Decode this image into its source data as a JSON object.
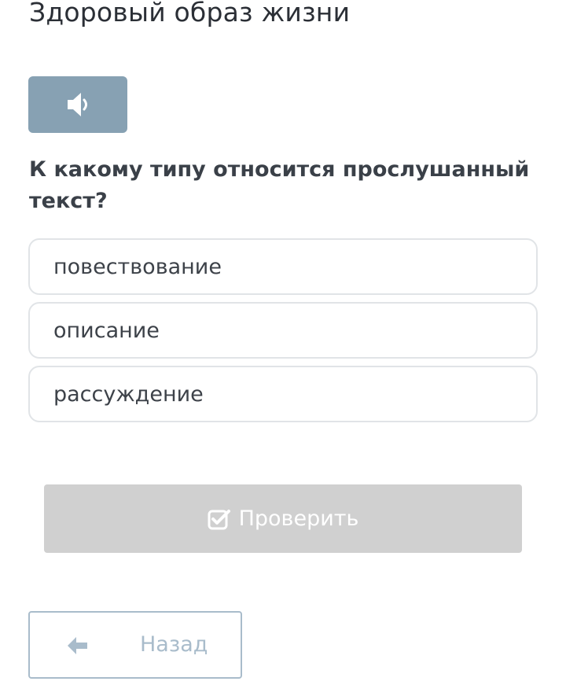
{
  "header": {
    "title": "Здоровый образ жизни"
  },
  "audio": {
    "icon": "speaker-icon",
    "color": "#87a1b3"
  },
  "question": {
    "text": "К какому типу относится прослушанный текст?"
  },
  "options": [
    {
      "label": "повествование"
    },
    {
      "label": "описание"
    },
    {
      "label": "рассуждение"
    }
  ],
  "check_button": {
    "label": "Проверить",
    "icon": "checkbox-icon",
    "color": "#d0d0d0"
  },
  "back_button": {
    "label": "Назад",
    "icon": "arrow-left-icon",
    "color": "#a9bccb"
  }
}
